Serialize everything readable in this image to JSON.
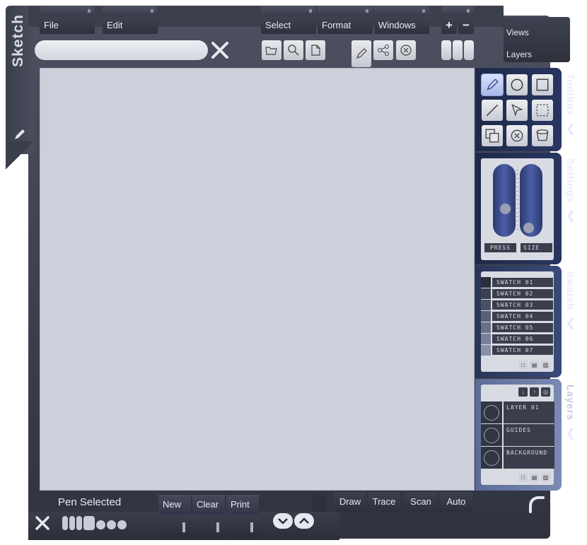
{
  "app": {
    "title": "Sketch"
  },
  "menu": {
    "file": "File",
    "edit": "Edit",
    "select": "Select",
    "format": "Format",
    "windows": "Windows",
    "plus": "+",
    "minus": "−",
    "views": "Views",
    "layers": "Layers"
  },
  "search": {
    "value": "",
    "placeholder": ""
  },
  "panels": {
    "toolbox": "Toolbox",
    "settings": "Settings",
    "swatch": "Swatch",
    "layers": "Layers"
  },
  "settings": {
    "press_label": "PRESS",
    "size_label": "SIZE",
    "press_level": 0.3,
    "size_level": 0.05
  },
  "swatches": [
    {
      "label": "SWATCH 01",
      "color": "#2b2f3b"
    },
    {
      "label": "SWATCH 02",
      "color": "#3b4050"
    },
    {
      "label": "SWATCH 03",
      "color": "#4b5064"
    },
    {
      "label": "SWATCH 04",
      "color": "#5a6076"
    },
    {
      "label": "SWATCH 05",
      "color": "#6a7088"
    },
    {
      "label": "SWATCH 06",
      "color": "#7a809a"
    },
    {
      "label": "SWATCH 07",
      "color": "#8a90aa"
    }
  ],
  "layers": [
    {
      "name": "LAYER 01"
    },
    {
      "name": "GUIDES"
    },
    {
      "name": "BACKGROUND"
    }
  ],
  "status": {
    "text": "Pen Selected"
  },
  "bottom": {
    "new": "New",
    "clear": "Clear",
    "print": "Print",
    "draw": "Draw",
    "trace": "Trace",
    "scan": "Scan",
    "auto": "Auto"
  },
  "colors": {
    "accent_panel": "#26325a",
    "canvas": "#cdcfda",
    "frame": "#3c3f4c"
  }
}
